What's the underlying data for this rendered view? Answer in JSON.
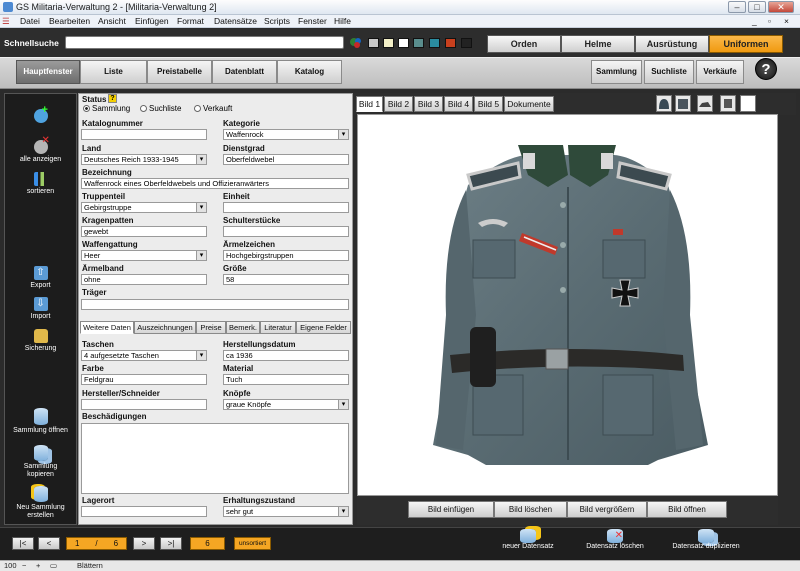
{
  "window": {
    "title": "GS Militaria-Verwaltung 2 - [Militaria-Verwaltung 2]",
    "minimize": "–",
    "maximize": "□",
    "close": "✕"
  },
  "menu": [
    "Datei",
    "Bearbeiten",
    "Ansicht",
    "Einfügen",
    "Format",
    "Datensätze",
    "Scripts",
    "Fenster",
    "Hilfe"
  ],
  "search": {
    "label": "Schnellsuche",
    "value": ""
  },
  "swatch_colors": [
    "#c8c8c8",
    "#f3f0c8",
    "#ffffff",
    "#5a8d8d",
    "#2a8ca0",
    "#c8401e",
    "#222222"
  ],
  "category_tabs": [
    {
      "label": "Orden",
      "active": false
    },
    {
      "label": "Helme",
      "active": false
    },
    {
      "label": "Ausrüstung",
      "active": false
    },
    {
      "label": "Uniformen",
      "active": true
    }
  ],
  "nav": {
    "left": [
      "Hauptfenster",
      "Liste",
      "Preistabelle",
      "Datenblatt",
      "Katalog"
    ],
    "right": [
      "Sammlung",
      "Suchliste",
      "Verkäufe"
    ],
    "help": "?"
  },
  "sidebar": {
    "top": [
      {
        "label": "",
        "icon": "add-record-icon"
      },
      {
        "label": "alle anzeigen",
        "icon": "show-all-icon"
      },
      {
        "label": "sortieren",
        "icon": "sort-icon"
      }
    ],
    "middle": [
      {
        "label": "Export",
        "icon": "export-icon"
      },
      {
        "label": "Import",
        "icon": "import-icon"
      },
      {
        "label": "Sicherung",
        "icon": "backup-lock-icon"
      }
    ],
    "bottom": [
      {
        "label": "Sammlung öffnen",
        "icon": "database-icon"
      },
      {
        "label": "Sammlung kopieren",
        "icon": "database-copy-icon"
      },
      {
        "label": "Neu Sammlung erstellen",
        "icon": "database-new-icon"
      }
    ]
  },
  "form": {
    "status": {
      "label": "Status",
      "options": [
        "Sammlung",
        "Suchliste",
        "Verkauft"
      ],
      "selected": "Sammlung"
    },
    "katalognummer": {
      "label": "Katalognummer",
      "value": ""
    },
    "kategorie": {
      "label": "Kategorie",
      "value": "Waffenrock"
    },
    "land": {
      "label": "Land",
      "value": "Deutsches Reich 1933-1945"
    },
    "dienstgrad": {
      "label": "Dienstgrad",
      "value": "Oberfeldwebel"
    },
    "bezeichnung": {
      "label": "Bezeichnung",
      "value": "Waffenrock eines Oberfeldwebels und Offizieranwärters"
    },
    "truppenteil": {
      "label": "Truppenteil",
      "value": "Gebirgstruppe"
    },
    "einheit": {
      "label": "Einheit",
      "value": ""
    },
    "kragenpatten": {
      "label": "Kragenpatten",
      "value": "gewebt"
    },
    "schulterstuecke": {
      "label": "Schulterstücke",
      "value": ""
    },
    "waffengattung": {
      "label": "Waffengattung",
      "value": "Heer"
    },
    "aermelzeichen": {
      "label": "Ärmelzeichen",
      "value": "Hochgebirgstruppen"
    },
    "aermelband": {
      "label": "Ärmelband",
      "value": "ohne"
    },
    "groesse": {
      "label": "Größe",
      "value": "58"
    },
    "traeger": {
      "label": "Träger",
      "value": ""
    }
  },
  "subtabs": [
    "Weitere Daten",
    "Auszeichnungen",
    "Preise",
    "Bemerk.",
    "Literatur",
    "Eigene Felder"
  ],
  "details": {
    "taschen": {
      "label": "Taschen",
      "value": "4 aufgesetzte Taschen"
    },
    "herstellungsdatum": {
      "label": "Herstellungsdatum",
      "value": "ca 1936"
    },
    "farbe": {
      "label": "Farbe",
      "value": "Feldgrau"
    },
    "material": {
      "label": "Material",
      "value": "Tuch"
    },
    "hersteller": {
      "label": "Hersteller/Schneider",
      "value": ""
    },
    "knoepfe": {
      "label": "Knöpfe",
      "value": "graue Knöpfe"
    },
    "beschaedigungen": {
      "label": "Beschädigungen",
      "value": ""
    },
    "lagerort": {
      "label": "Lagerort",
      "value": ""
    },
    "erhaltungszustand": {
      "label": "Erhaltungszustand",
      "value": "sehr gut"
    }
  },
  "image_tabs": [
    "Bild 1",
    "Bild 2",
    "Bild 3",
    "Bild 4",
    "Bild 5",
    "Dokumente"
  ],
  "image_buttons": [
    "Bild einfügen",
    "Bild löschen",
    "Bild vergrößern",
    "Bild öffnen"
  ],
  "records": {
    "first": "|<",
    "prev": "<",
    "current": "1",
    "sep": "/",
    "total": "6",
    "next": ">",
    "last": ">|",
    "found": "6",
    "sort_state": "unsortiert"
  },
  "record_actions": [
    "neuer Datensatz",
    "Datensatz löschen",
    "Datensatz duplizieren"
  ],
  "statusbar": {
    "zoom": "100",
    "mode": "Blättern"
  }
}
